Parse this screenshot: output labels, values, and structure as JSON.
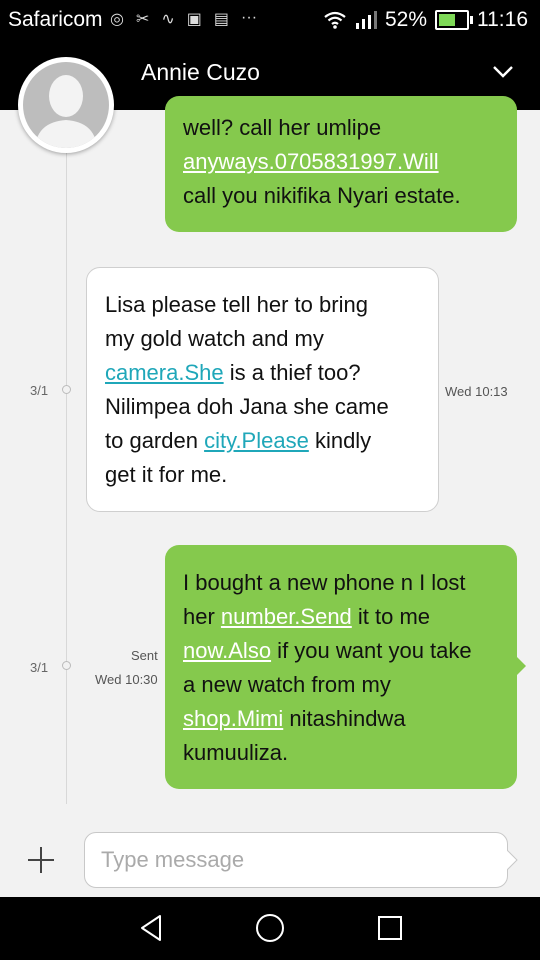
{
  "status_bar": {
    "carrier": "Safaricom",
    "battery": "52%",
    "battery_level": 0.52,
    "time": "11:16"
  },
  "header": {
    "contact_name": "Annie Cuzo"
  },
  "messages": [
    {
      "direction": "sent",
      "segments": [
        {
          "text": "well? call her umlipe\n",
          "link": false
        },
        {
          "text": "anyways.0705831997.Will",
          "link": true
        },
        {
          "text": "\ncall you nikifika Nyari estate.",
          "link": false
        }
      ]
    },
    {
      "direction": "received",
      "date": "3/1",
      "time": "Wed 10:13",
      "segments": [
        {
          "text": "Lisa please tell her to bring\nmy gold watch and my\n",
          "link": false
        },
        {
          "text": "camera.She",
          "link": true
        },
        {
          "text": " is a thief too?\nNilimpea doh Jana she came\nto garden ",
          "link": false
        },
        {
          "text": "city.Please",
          "link": true
        },
        {
          "text": " kindly\nget it for me.",
          "link": false
        }
      ]
    },
    {
      "direction": "sent",
      "date": "3/1",
      "status": "Sent",
      "time": "Wed 10:30",
      "segments": [
        {
          "text": "I bought a new phone n I lost\nher ",
          "link": false
        },
        {
          "text": "number.Send",
          "link": true
        },
        {
          "text": " it to me\n",
          "link": false
        },
        {
          "text": "now.Also",
          "link": true
        },
        {
          "text": " if you want you take\na new watch from my\n",
          "link": false
        },
        {
          "text": "shop.Mimi",
          "link": true
        },
        {
          "text": " nitashindwa\nkumuuliza.",
          "link": false
        }
      ]
    }
  ],
  "composer": {
    "placeholder": "Type message"
  },
  "colors": {
    "sent_bubble": "#85c94d",
    "link_in": "#1fa7b9",
    "bar_bg": "#000000"
  },
  "icons": [
    "signal-icon",
    "wifi-icon",
    "battery-icon",
    "chevron-down-icon",
    "add-icon",
    "back-icon",
    "home-icon",
    "recents-icon"
  ]
}
